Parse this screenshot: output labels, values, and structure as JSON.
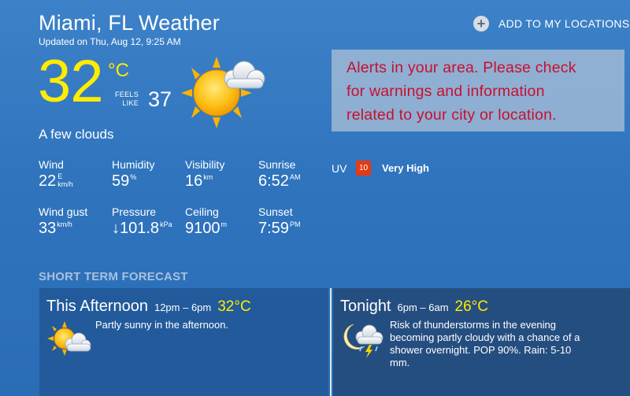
{
  "header": {
    "title": "Miami, FL Weather",
    "updated": "Updated on Thu, Aug 12, 9:25 AM",
    "add_location_label": "ADD TO MY LOCATIONS"
  },
  "current": {
    "temperature": "32",
    "unit": "°C",
    "feels_like_label_1": "FEELS",
    "feels_like_label_2": "LIKE",
    "feels_like_value": "37",
    "condition": "A few clouds",
    "icon": "partly-sunny-icon"
  },
  "alert": {
    "line1": "Alerts in your area. Please check",
    "line2": "for warnings and information",
    "line3": "related to your city or location."
  },
  "stats": {
    "wind": {
      "label": "Wind",
      "value": "22",
      "dir": "E",
      "unit": "km/h"
    },
    "humidity": {
      "label": "Humidity",
      "value": "59",
      "unit": "%"
    },
    "visibility": {
      "label": "Visibility",
      "value": "16",
      "unit": "km"
    },
    "sunrise": {
      "label": "Sunrise",
      "value": "6:52",
      "unit": "AM"
    },
    "wind_gust": {
      "label": "Wind gust",
      "value": "33",
      "unit": "km/h"
    },
    "pressure": {
      "label": "Pressure",
      "value": "↓101.8",
      "unit": "kPa"
    },
    "ceiling": {
      "label": "Ceiling",
      "value": "9100",
      "unit": "m"
    },
    "sunset": {
      "label": "Sunset",
      "value": "7:59",
      "unit": "PM"
    }
  },
  "uv": {
    "label": "UV",
    "index": "10",
    "level": "Very High",
    "color": "#e53a14"
  },
  "short_term": {
    "heading": "SHORT TERM FORECAST",
    "periods": [
      {
        "name": "This Afternoon",
        "time": "12pm – 6pm",
        "temp": "32°C",
        "desc_lines": [
          "Partly sunny in the afternoon."
        ],
        "icon": "partly-sunny-icon"
      },
      {
        "name": "Tonight",
        "time": "6pm – 6am",
        "temp": "26°C",
        "desc_lines": [
          "Risk of thunderstorms in the evening",
          "becoming partly cloudy with a chance of a",
          "shower overnight. POP 90%. Rain: 5-10",
          "mm."
        ],
        "icon": "moon-thunderstorm-icon"
      }
    ]
  },
  "colors": {
    "accent_yellow": "#ffec00",
    "alert_red": "#c8102e"
  }
}
